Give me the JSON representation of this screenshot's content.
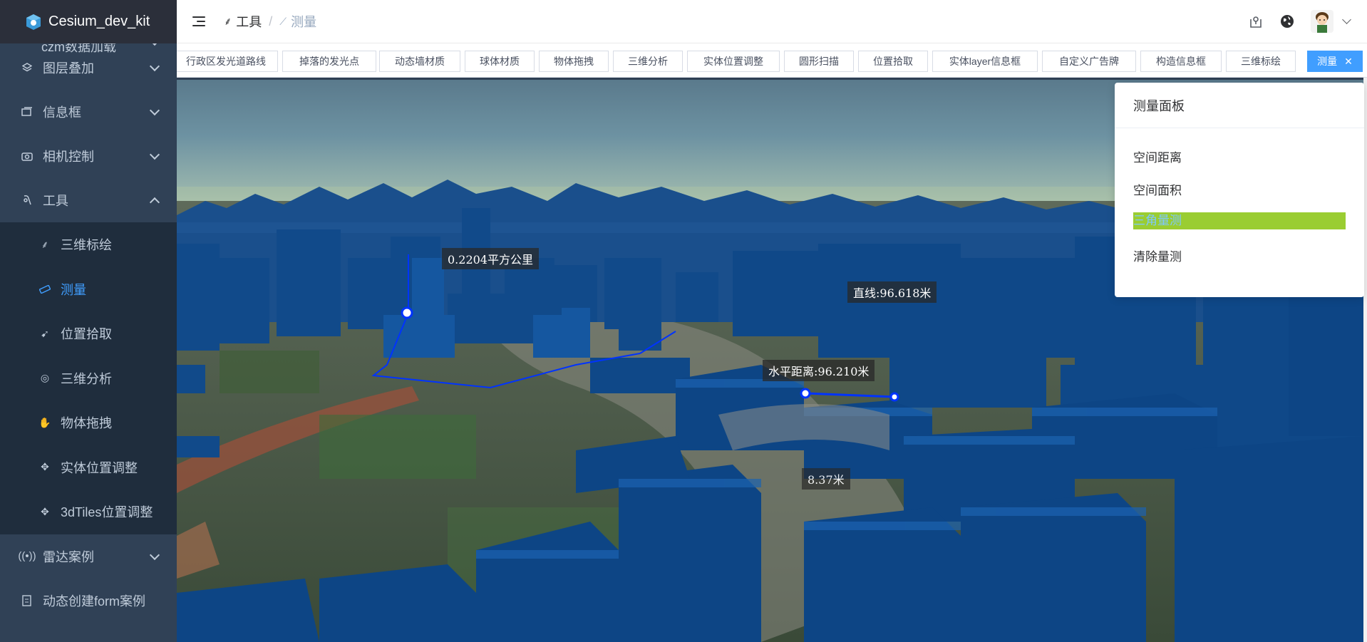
{
  "brand": {
    "title": "Cesium_dev_kit"
  },
  "sidebar": {
    "partial_item": "czm数据加载",
    "items": [
      {
        "label": "图层叠加",
        "icon": "layers-icon"
      },
      {
        "label": "信息框",
        "icon": "info-box-icon"
      },
      {
        "label": "相机控制",
        "icon": "camera-icon"
      },
      {
        "label": "工具",
        "icon": "tool-icon"
      }
    ],
    "sub_items": [
      {
        "label": "三维标绘",
        "icon": "draw-icon"
      },
      {
        "label": "测量",
        "icon": "ruler-icon",
        "active": true
      },
      {
        "label": "位置拾取",
        "icon": "pick-icon"
      },
      {
        "label": "三维分析",
        "icon": "analysis-icon"
      },
      {
        "label": "物体拖拽",
        "icon": "drag-icon"
      },
      {
        "label": "实体位置调整",
        "icon": "move-icon"
      },
      {
        "label": "3dTiles位置调整",
        "icon": "move-icon"
      }
    ],
    "bottom_items": [
      {
        "label": "雷达案例",
        "icon": "radar-icon"
      },
      {
        "label": "动态创建form案例",
        "icon": "form-icon"
      }
    ]
  },
  "header": {
    "breadcrumb": [
      {
        "label": "工具"
      },
      {
        "label": "测量"
      }
    ],
    "separator": "/"
  },
  "tags": [
    {
      "label": "行政区发光道路线"
    },
    {
      "label": "掉落的发光点"
    },
    {
      "label": "动态墙材质"
    },
    {
      "label": "球体材质"
    },
    {
      "label": "物体拖拽"
    },
    {
      "label": "三维分析"
    },
    {
      "label": "实体位置调整"
    },
    {
      "label": "圆形扫描"
    },
    {
      "label": "位置拾取"
    },
    {
      "label": "实体layer信息框"
    },
    {
      "label": "自定义广告牌"
    },
    {
      "label": "构造信息框"
    },
    {
      "label": "三维标绘"
    },
    {
      "label": "测量",
      "active": true,
      "close": "✕"
    }
  ],
  "map_labels": {
    "area": "0.2204平方公里",
    "straight": "直线:96.618米",
    "horizontal": "水平距离:96.210米",
    "partial": "8.37米"
  },
  "panel": {
    "title": "测量面板",
    "options": [
      "空间距离",
      "空间面积",
      "三角量测",
      "清除量测"
    ]
  },
  "colors": {
    "sidebar_bg": "#304156",
    "accent": "#409eff",
    "building": "#0f4a8c",
    "highlight": "#9acd32"
  }
}
